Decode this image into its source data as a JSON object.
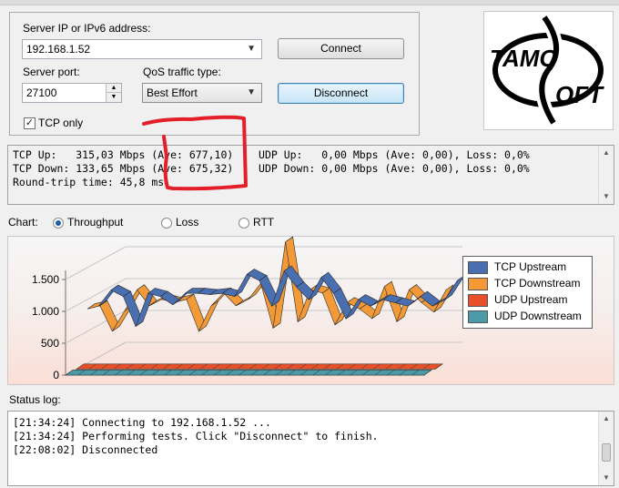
{
  "connection": {
    "server_label": "Server IP or IPv6  address:",
    "server_value": "192.168.1.52",
    "port_label": "Server port:",
    "port_value": "27100",
    "qos_label": "QoS traffic type:",
    "qos_value": "Best Effort",
    "tcp_only_label": "TCP only",
    "tcp_only_checked": true,
    "connect_label": "Connect",
    "disconnect_label": "Disconnect"
  },
  "logo": {
    "text": "TAMOSOFT",
    "icon": "tamosoft-logo"
  },
  "stats": {
    "line1": "TCP Up:   315,03 Mbps (Ave: 677,10)    UDP Up:   0,00 Mbps (Ave: 0,00), Loss: 0,0%",
    "line2": "TCP Down: 133,65 Mbps (Ave: 675,32)    UDP Down: 0,00 Mbps (Ave: 0,00), Loss: 0,0%",
    "line3": "Round-trip time: 45,8 ms"
  },
  "chart_selector": {
    "label": "Chart:",
    "options": [
      "Throughput",
      "Loss",
      "RTT"
    ],
    "selected": "Throughput"
  },
  "chart_data": {
    "type": "line",
    "title": "",
    "xlabel": "",
    "ylabel": "",
    "ylim": [
      0,
      1500
    ],
    "y_ticks": [
      "0",
      "500",
      "1.000",
      "1.500"
    ],
    "legend_position": "right",
    "series": [
      {
        "name": "TCP Upstream",
        "color": "#4a6fb0",
        "values": [
          800,
          1050,
          950,
          480,
          1000,
          950,
          820,
          1000,
          1000,
          980,
          1000,
          950,
          1300,
          1200,
          800,
          1350,
          1100,
          900,
          1250,
          1000,
          600,
          900,
          800,
          900,
          850,
          800,
          950,
          800,
          900,
          1200
        ]
      },
      {
        "name": "TCP Downstream",
        "color": "#f29a38",
        "values": [
          850,
          900,
          500,
          820,
          1150,
          900,
          1000,
          950,
          1000,
          500,
          900,
          1100,
          900,
          1000,
          1250,
          550,
          1900,
          650,
          1150,
          1100,
          600,
          950,
          850,
          700,
          1200,
          650,
          1150,
          950,
          800,
          1150
        ]
      },
      {
        "name": "UDP Upstream",
        "color": "#e8502a",
        "values": [
          0,
          0,
          0,
          0,
          0,
          0,
          0,
          0,
          0,
          0,
          0,
          0,
          0,
          0,
          0,
          0,
          0,
          0,
          0,
          0,
          0,
          0,
          0,
          0,
          0,
          0,
          0,
          0,
          0,
          0
        ]
      },
      {
        "name": "UDP Downstream",
        "color": "#4a9aa8",
        "values": [
          0,
          0,
          0,
          0,
          0,
          0,
          0,
          0,
          0,
          0,
          0,
          0,
          0,
          0,
          0,
          0,
          0,
          0,
          0,
          0,
          0,
          0,
          0,
          0,
          0,
          0,
          0,
          0,
          0,
          0
        ]
      }
    ]
  },
  "status_log": {
    "label": "Status log:",
    "lines": [
      "[21:34:24] Connecting to 192.168.1.52 ...",
      "[21:34:24] Performing tests. Click \"Disconnect\" to finish.",
      "[22:08:02] Disconnected"
    ]
  }
}
